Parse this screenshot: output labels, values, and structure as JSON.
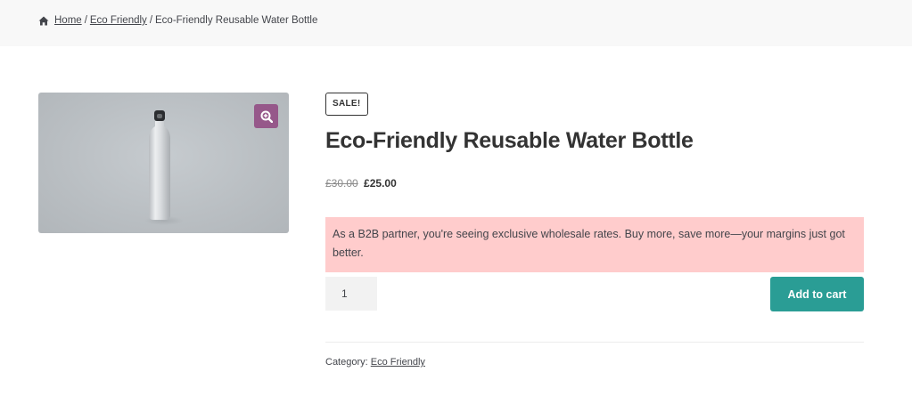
{
  "breadcrumb": {
    "home_icon": "home-icon",
    "home_label": "Home",
    "category_label": "Eco Friendly",
    "current_label": "Eco-Friendly Reusable Water Bottle",
    "separator": "/"
  },
  "gallery": {
    "image_alt": "Aluminium water bottle",
    "zoom_icon": "zoom-in-icon",
    "zoom_color": "#96588a"
  },
  "product": {
    "sale_badge": "SALE!",
    "title": "Eco-Friendly Reusable Water Bottle",
    "price_old": "£30.00",
    "price_new": "£25.00",
    "notice": "As a B2B partner, you're seeing exclusive wholesale rates. Buy more, save more—your margins just got better.",
    "notice_bg": "#ffcccc",
    "quantity": "1",
    "add_to_cart_label": "Add to cart",
    "add_to_cart_color": "#2a9d95",
    "category_prefix": "Category:",
    "category_link": "Eco Friendly"
  }
}
